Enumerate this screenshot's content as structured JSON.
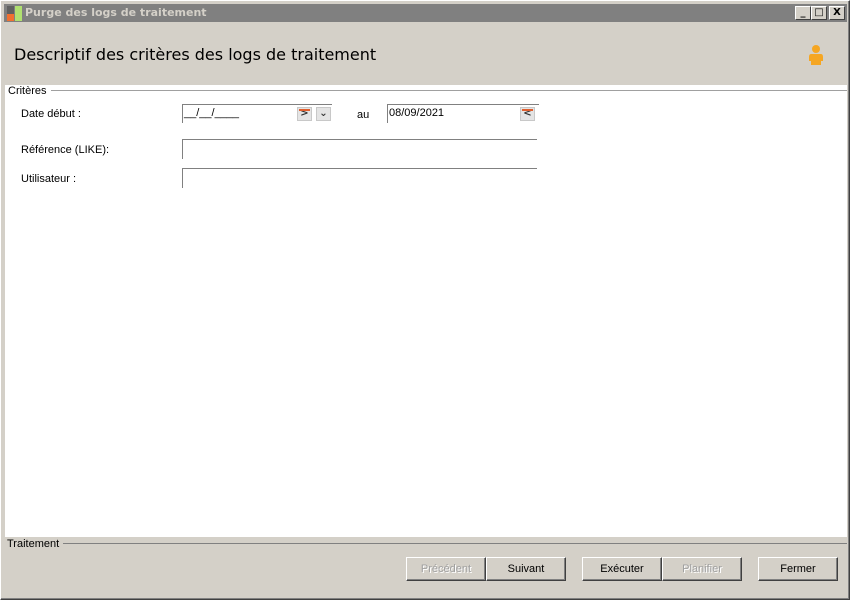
{
  "window": {
    "title": "Purge des logs de traitement",
    "minimize": "_",
    "maximize": "□",
    "close": "X"
  },
  "header": {
    "title": "Descriptif des critères des logs de traitement",
    "icon": "person-icon"
  },
  "criteria": {
    "legend": "Critères",
    "date_start_label": "Date début :",
    "date_start_value": "__/__/____",
    "to_label": "au",
    "date_end_value": "08/09/2021",
    "reference_label": "Référence (LIKE):",
    "reference_value": "",
    "user_label": "Utilisateur :",
    "user_value": ""
  },
  "footer": {
    "legend": "Traitement",
    "buttons": {
      "previous": "Précédent",
      "next": "Suivant",
      "execute": "Exécuter",
      "schedule": "Planifier",
      "close": "Fermer"
    }
  },
  "colors": {
    "accent": "#f5a623",
    "titlebar": "#808080"
  }
}
